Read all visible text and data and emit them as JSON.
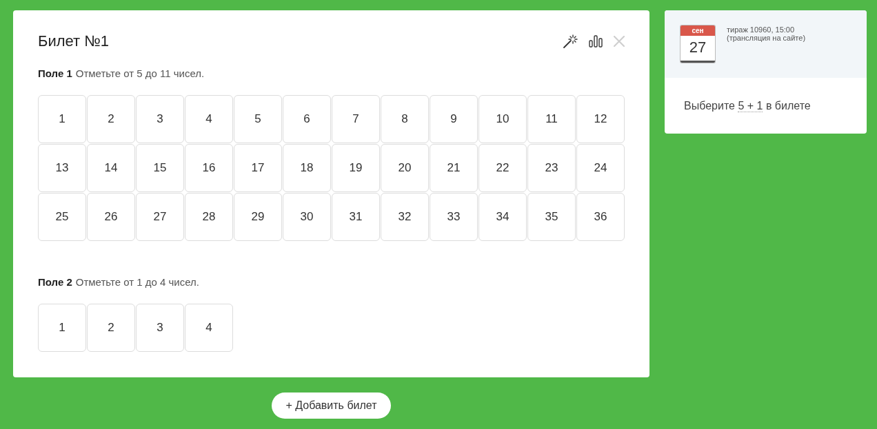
{
  "ticket": {
    "title": "Билет №1",
    "fields": [
      {
        "label": "Поле 1",
        "hint": "Отметьте от 5 до 11 чисел.",
        "numbers": [
          {
            "text": "1",
            "selected": false
          },
          {
            "text": "2",
            "selected": false
          },
          {
            "text": "3",
            "selected": false
          },
          {
            "text": "4",
            "selected": false
          },
          {
            "text": "5",
            "selected": false
          },
          {
            "text": "6",
            "selected": false
          },
          {
            "text": "7",
            "selected": false
          },
          {
            "text": "8",
            "selected": false
          },
          {
            "text": "9",
            "selected": false
          },
          {
            "text": "10",
            "selected": false
          },
          {
            "text": "11",
            "selected": false
          },
          {
            "text": "12",
            "selected": false
          },
          {
            "text": "13",
            "selected": false
          },
          {
            "text": "14",
            "selected": false
          },
          {
            "text": "15",
            "selected": false
          },
          {
            "text": "16",
            "selected": false
          },
          {
            "text": "17",
            "selected": false
          },
          {
            "text": "18",
            "selected": false
          },
          {
            "text": "19",
            "selected": false
          },
          {
            "text": "20",
            "selected": false
          },
          {
            "text": "21",
            "selected": false
          },
          {
            "text": "22",
            "selected": false
          },
          {
            "text": "23",
            "selected": false
          },
          {
            "text": "24",
            "selected": false
          },
          {
            "text": "25",
            "selected": false
          },
          {
            "text": "26",
            "selected": false
          },
          {
            "text": "27",
            "selected": false
          },
          {
            "text": "28",
            "selected": false
          },
          {
            "text": "29",
            "selected": false
          },
          {
            "text": "30",
            "selected": false
          },
          {
            "text": "31",
            "selected": false
          },
          {
            "text": "32",
            "selected": false
          },
          {
            "text": "33",
            "selected": false
          },
          {
            "text": "34",
            "selected": false
          },
          {
            "text": "35",
            "selected": false
          },
          {
            "text": "36",
            "selected": false
          }
        ]
      },
      {
        "label": "Поле 2",
        "hint": "Отметьте от 1 до 4 чисел.",
        "numbers": [
          {
            "text": "1",
            "selected": false
          },
          {
            "text": "2",
            "selected": false
          },
          {
            "text": "3",
            "selected": false
          },
          {
            "text": "4",
            "selected": false
          }
        ]
      }
    ]
  },
  "add_button": "+ Добавить билет",
  "draw": {
    "month": "сен",
    "day": "27",
    "lines": [
      "тираж 10960, 15:00",
      "(трансляция на сайте)"
    ]
  },
  "prompt": {
    "before": "Выберите",
    "link": "5 + 1",
    "after": "в билете"
  }
}
